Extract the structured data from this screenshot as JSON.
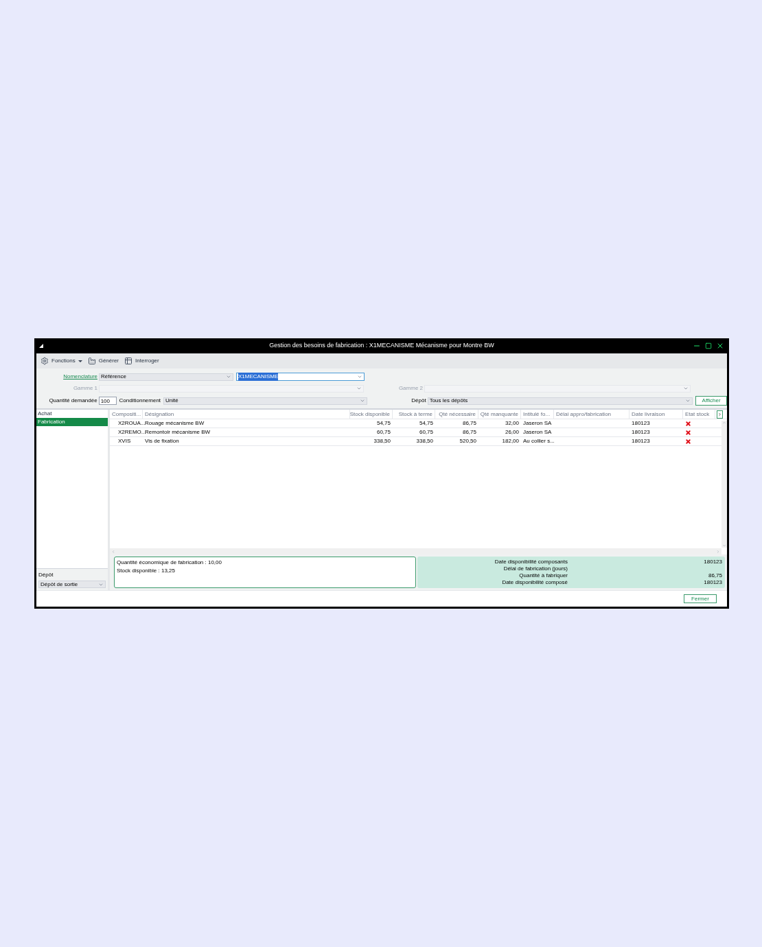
{
  "window": {
    "title": "Gestion des besoins de fabrication : X1MECANISME Mécanisme pour Montre BW"
  },
  "toolbar": [
    {
      "label": "Fonctions",
      "kind": "menu"
    },
    {
      "label": "Générer",
      "kind": "generate"
    },
    {
      "label": "Interroger",
      "kind": "query"
    }
  ],
  "form": {
    "nomenclature_label": "Nomenclature",
    "nomenclature_type": "Référence",
    "nomenclature_value": "X1MECANISME",
    "gamme1_label": "Gamme 1",
    "gamme2_label": "Gamme 2",
    "quantite_label": "Quantité demandée",
    "quantite_value": "100",
    "conditionnement_label": "Conditionnement",
    "conditionnement_value": "Unité",
    "depot_label": "Dépôt",
    "depot_value": "Tous les dépôts",
    "afficher": "Afficher"
  },
  "sidebar": {
    "items": [
      {
        "label": "Achat",
        "selected": false
      },
      {
        "label": "Fabrication",
        "selected": true
      }
    ],
    "depot_label": "Dépôt",
    "depot_value": "Dépôt de sortie"
  },
  "table": {
    "columns": [
      "Compositi...",
      "Désignation",
      "Stock disponible",
      "Stock à terme",
      "Qté nécessaire",
      "Qté manquante",
      "Intitulé fo...",
      "Délai appro/fabrication",
      "Date livraison",
      "Etat stock"
    ],
    "rows": [
      {
        "cells": [
          "X2ROUA...",
          "Rouage mécanisme BW",
          "54,75",
          "54,75",
          "86,75",
          "32,00",
          "Jaseron SA"
        ],
        "date": "180123",
        "stock_ok": false
      },
      {
        "cells": [
          "X2REMO...",
          "Remontoir mécanisme BW",
          "60,75",
          "60,75",
          "86,75",
          "26,00",
          "Jaseron SA"
        ],
        "date": "180123",
        "stock_ok": false
      },
      {
        "cells": [
          "XVIS",
          "Vis de fixation",
          "338,50",
          "338,50",
          "520,50",
          "182,00",
          "Au collier s..."
        ],
        "date": "180123",
        "stock_ok": false
      }
    ]
  },
  "info": [
    "Quantité économique de fabrication : 10,00",
    "Stock disponible : 13,25"
  ],
  "summary": [
    {
      "label": "Date disponibilité composants",
      "value": "180123"
    },
    {
      "label": "Délai de fabrication (jours)"
    },
    {
      "label": "Quantité à fabriquer",
      "value": "86,75"
    },
    {
      "label": "Date disponibilité composé",
      "value": "180123"
    }
  ],
  "footer": {
    "close": "Fermer"
  }
}
